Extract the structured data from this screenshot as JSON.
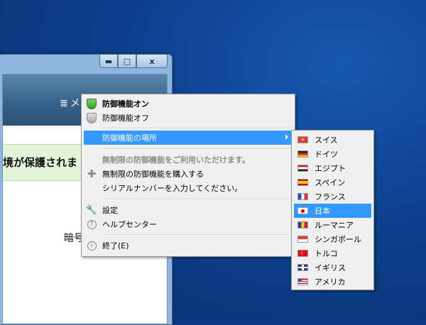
{
  "window": {
    "controls": {
      "minimize": "▬",
      "maximize": "□",
      "close": "x"
    },
    "menu_label": "メ",
    "banner_text": "境が保護されま",
    "encryption_text": "暗号"
  },
  "context_menu": {
    "protection_on": "防御機能オン",
    "protection_off": "防御機能オフ",
    "location": "防御機能の場所",
    "unlimited_notice": "無制限の防御機能をご利用いただけます。",
    "buy_unlimited": "無制限の防御機能を購入する",
    "enter_serial": "シリアルナンバーを入力してください。",
    "settings": "設定",
    "help_center": "ヘルプセンター",
    "exit": "終了(E)"
  },
  "submenu": {
    "items": [
      {
        "label": "スイス",
        "flag": "swiss-flag"
      },
      {
        "label": "ドイツ",
        "flag": "germany-flag"
      },
      {
        "label": "エジプト",
        "flag": "egypt-flag"
      },
      {
        "label": "スペイン",
        "flag": "spain-flag"
      },
      {
        "label": "フランス",
        "flag": "france-flag"
      },
      {
        "label": "日本",
        "flag": "japan-flag",
        "selected": true
      },
      {
        "label": "ルーマニア",
        "flag": "romania-flag"
      },
      {
        "label": "シンガポール",
        "flag": "singapore-flag"
      },
      {
        "label": "トルコ",
        "flag": "turkey-flag"
      },
      {
        "label": "イギリス",
        "flag": "uk-flag"
      },
      {
        "label": "アメリカ",
        "flag": "usa-flag"
      }
    ]
  },
  "colors": {
    "highlight": "#3399ff",
    "desktop": "#0e3f8c",
    "banner": "#e3f5d9"
  }
}
